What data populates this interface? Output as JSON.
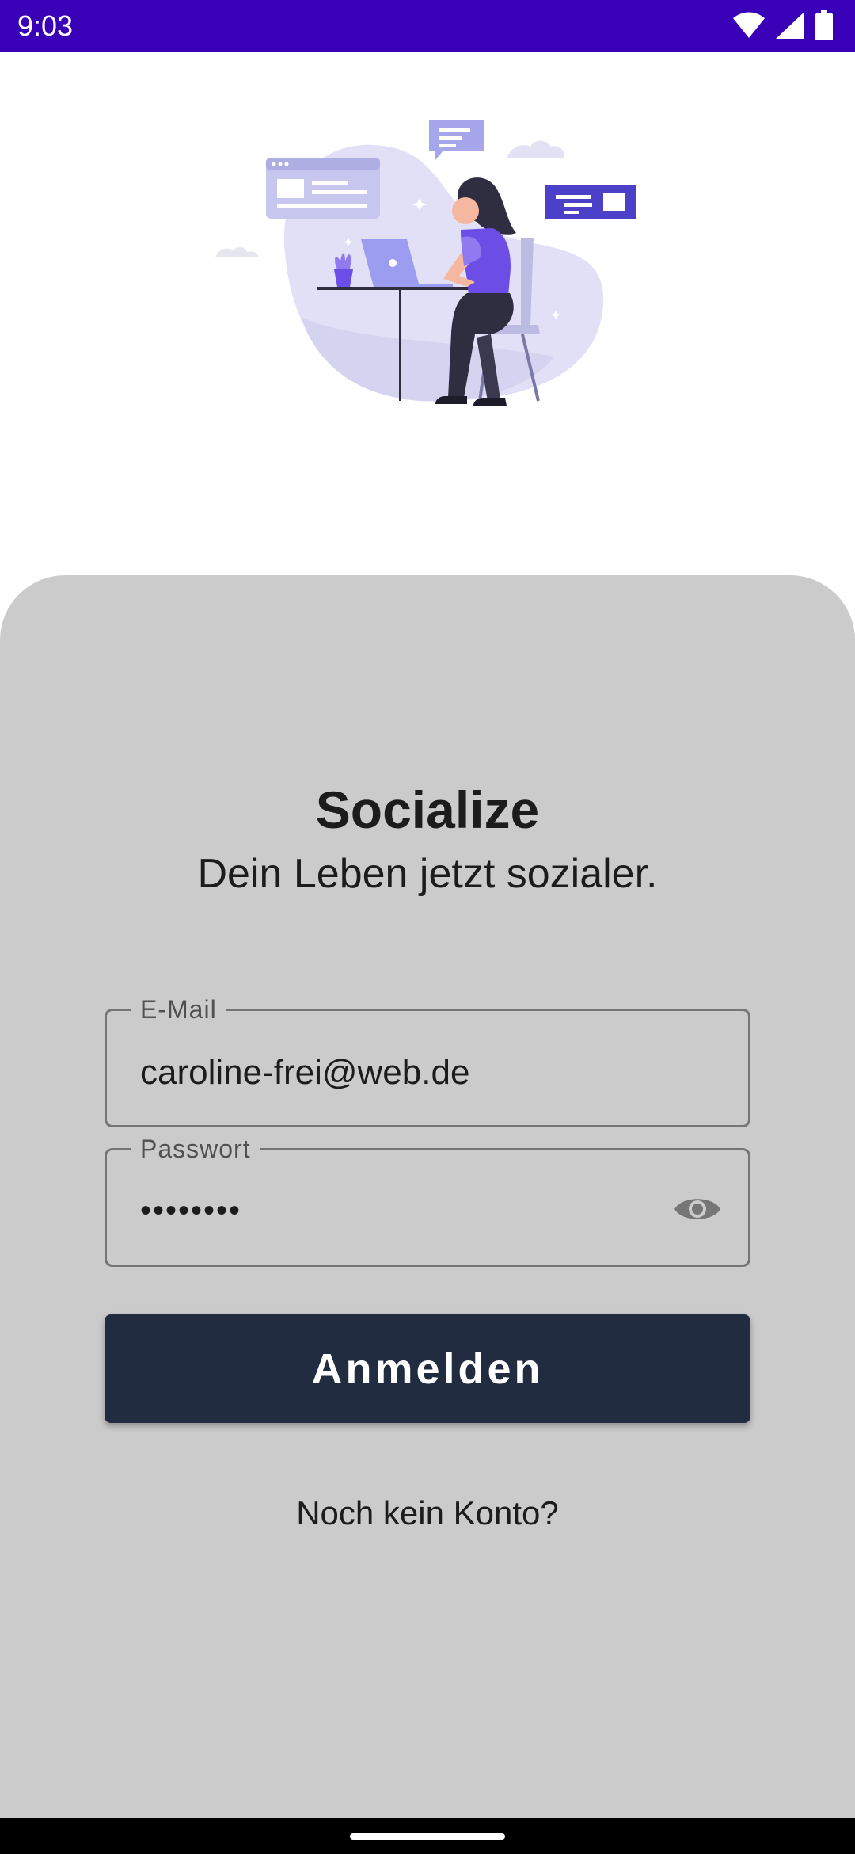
{
  "status_bar": {
    "time": "9:03",
    "icons": [
      "wifi-icon",
      "signal-icon",
      "battery-icon"
    ],
    "color": "#3a00b8"
  },
  "illustration": {
    "icon": "person-laptop-illustration"
  },
  "login": {
    "title": "Socialize",
    "tagline": "Dein Leben jetzt sozialer.",
    "email_label": "E-Mail",
    "email_value": "caroline-frei@web.de",
    "password_label": "Passwort",
    "password_value": "••••••••",
    "password_toggle_icon": "eye-icon",
    "submit_label": "Anmelden",
    "signup_link": "Noch kein Konto?"
  },
  "colors": {
    "sheet_background": "#cbcbcb",
    "button_background": "#212c40",
    "accent_purple": "#6c4ee6"
  }
}
